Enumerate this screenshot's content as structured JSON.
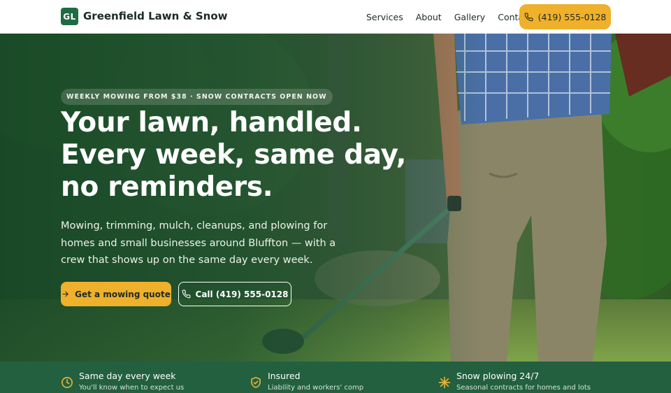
{
  "brand": {
    "initials": "GL",
    "name": "Greenfield Lawn & Snow"
  },
  "nav": {
    "items": [
      {
        "label": "Services"
      },
      {
        "label": "About"
      },
      {
        "label": "Gallery"
      },
      {
        "label": "Contact"
      }
    ],
    "phone_button": "(419) 555-0128"
  },
  "hero": {
    "eyebrow": "WEEKLY MOWING FROM $38 · SNOW CONTRACTS OPEN NOW",
    "headline_lines": [
      "Your lawn, handled.",
      "Every week, same day,",
      "no reminders."
    ],
    "lead_lines": [
      "Mowing, trimming, mulch, cleanups, and plowing for",
      "homes and small businesses around Bluffton — with a",
      "crew that shows up on the same day every week."
    ],
    "primary_cta": "Get a mowing quote",
    "secondary_cta": "Call (419) 555-0128"
  },
  "features": [
    {
      "icon": "clock-icon",
      "title": "Same day every week",
      "subtitle": "You'll know when to expect us"
    },
    {
      "icon": "shield-check-icon",
      "title": "Insured",
      "subtitle": "Liability and workers' comp"
    },
    {
      "icon": "snowflake-icon",
      "title": "Snow plowing 24/7",
      "subtitle": "Seasonal contracts for homes and lots"
    }
  ],
  "colors": {
    "brand_green": "#1f6b43",
    "accent_yellow": "#efb02b",
    "strip_green": "#22603f",
    "icon_yellow": "#e8b23a"
  }
}
